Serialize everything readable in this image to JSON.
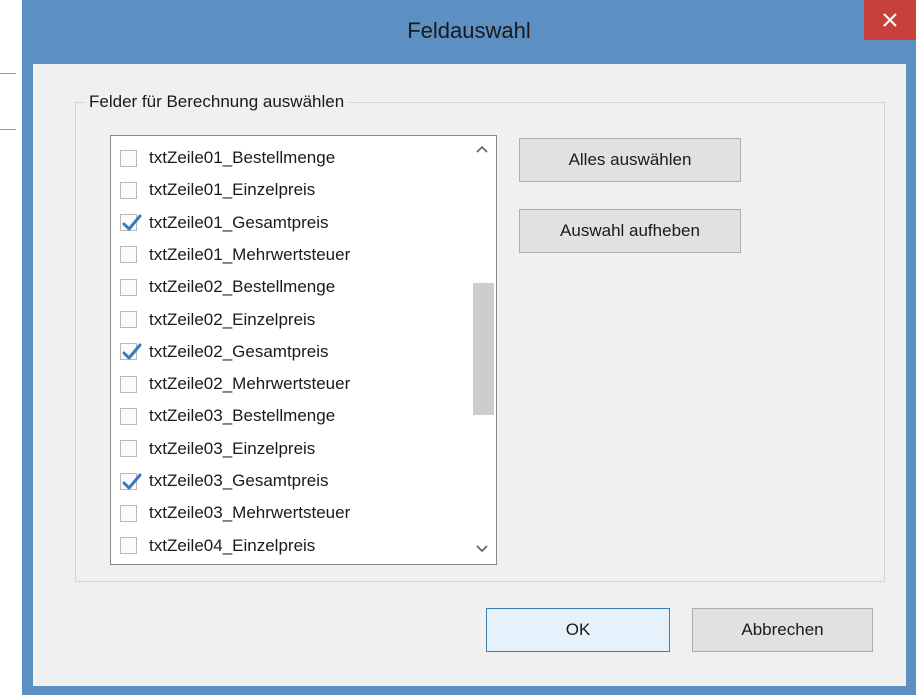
{
  "window": {
    "title": "Feldauswahl"
  },
  "group": {
    "label": "Felder für Berechnung auswählen"
  },
  "fields": [
    {
      "label": "txtZeile01_Bestellmenge",
      "checked": false
    },
    {
      "label": "txtZeile01_Einzelpreis",
      "checked": false
    },
    {
      "label": "txtZeile01_Gesamtpreis",
      "checked": true
    },
    {
      "label": "txtZeile01_Mehrwertsteuer",
      "checked": false
    },
    {
      "label": "txtZeile02_Bestellmenge",
      "checked": false
    },
    {
      "label": "txtZeile02_Einzelpreis",
      "checked": false
    },
    {
      "label": "txtZeile02_Gesamtpreis",
      "checked": true
    },
    {
      "label": "txtZeile02_Mehrwertsteuer",
      "checked": false
    },
    {
      "label": "txtZeile03_Bestellmenge",
      "checked": false
    },
    {
      "label": "txtZeile03_Einzelpreis",
      "checked": false
    },
    {
      "label": "txtZeile03_Gesamtpreis",
      "checked": true
    },
    {
      "label": "txtZeile03_Mehrwertsteuer",
      "checked": false
    },
    {
      "label": "txtZeile04_Einzelpreis",
      "checked": false
    }
  ],
  "buttons": {
    "select_all": "Alles auswählen",
    "clear_selection": "Auswahl aufheben",
    "ok": "OK",
    "cancel": "Abbrechen"
  },
  "colors": {
    "title_bar": "#5d90c2",
    "close_button": "#c7403a",
    "check_mark": "#3a78c2"
  }
}
